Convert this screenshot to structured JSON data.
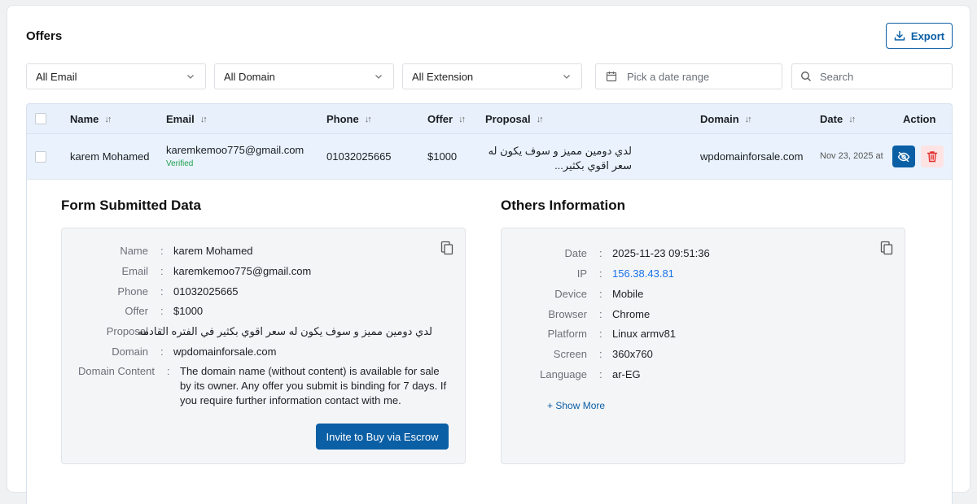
{
  "header": {
    "title": "Offers",
    "export_label": "Export"
  },
  "filters": {
    "email": "All Email",
    "domain": "All Domain",
    "extension": "All Extension",
    "date_placeholder": "Pick a date range",
    "search_placeholder": "Search"
  },
  "table": {
    "columns": [
      "Name",
      "Email",
      "Phone",
      "Offer",
      "Proposal",
      "Domain",
      "Date",
      "Action"
    ],
    "rows": [
      {
        "name": "karem Mohamed",
        "email": "karemkemoo775@gmail.com",
        "email_status": "Verified",
        "phone": "01032025665",
        "offer": "$1000",
        "proposal": "لدي دومين مميز و سوف يكون له سعر اقوي بكثير...",
        "domain": "wpdomainforsale.com",
        "date": "Nov 23, 2025 at"
      }
    ]
  },
  "form_data": {
    "title": "Form Submitted Data",
    "fields": [
      {
        "label": "Name",
        "value": "karem Mohamed"
      },
      {
        "label": "Email",
        "value": "karemkemoo775@gmail.com"
      },
      {
        "label": "Phone",
        "value": "01032025665"
      },
      {
        "label": "Offer",
        "value": "$1000"
      },
      {
        "label": "Proposal",
        "value": "لدي دومين مميز و سوف يكون له سعر اقوي بكثير في الفتره القادمه"
      },
      {
        "label": "Domain",
        "value": "wpdomainforsale.com"
      }
    ],
    "domain_content_label": "Domain Content",
    "domain_content_lines": [
      "The domain name (without content) is available for sale",
      "by its owner. Any offer you submit is binding for 7 days. If",
      "you require further information contact with me."
    ],
    "escrow_label": "Invite to Buy via Escrow"
  },
  "others": {
    "title": "Others Information",
    "fields": [
      {
        "label": "Date",
        "value": "2025-11-23 09:51:36"
      },
      {
        "label": "IP",
        "value": "156.38.43.81"
      },
      {
        "label": "Device",
        "value": "Mobile"
      },
      {
        "label": "Browser",
        "value": "Chrome"
      },
      {
        "label": "Platform",
        "value": "Linux armv81"
      },
      {
        "label": "Screen",
        "value": "360x760"
      },
      {
        "label": "Language",
        "value": "ar-EG"
      }
    ],
    "show_more_label": "+ Show More"
  },
  "colors": {
    "accent": "#0b5fa5",
    "verified": "#1e9e4a",
    "danger": "#e03131",
    "link": "#1a73e8"
  }
}
